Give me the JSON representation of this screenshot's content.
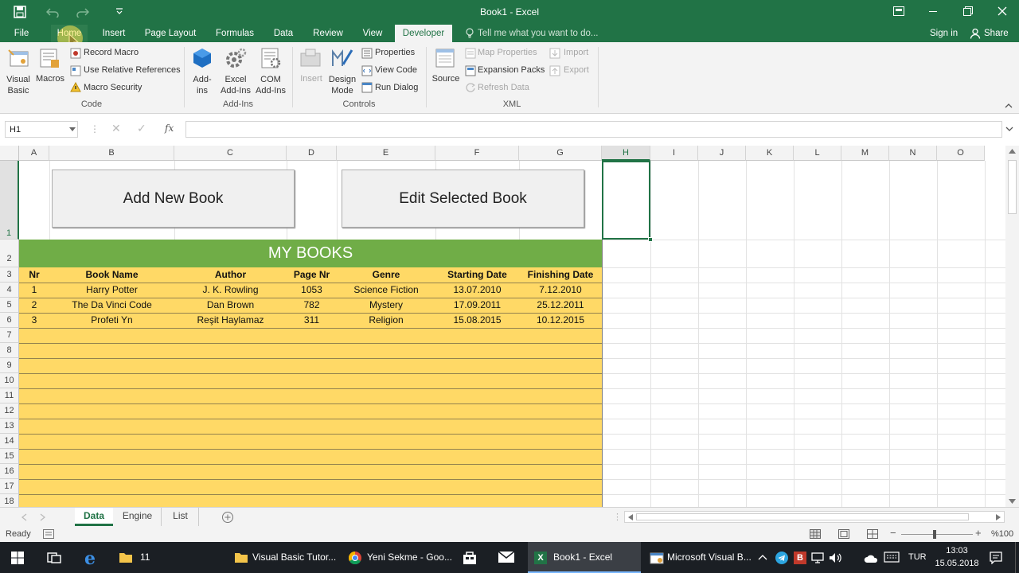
{
  "window": {
    "title": "Book1 - Excel"
  },
  "tabs": [
    "File",
    "Home",
    "Insert",
    "Page Layout",
    "Formulas",
    "Data",
    "Review",
    "View",
    "Developer"
  ],
  "tell_me": "Tell me what you want to do...",
  "sign_in": "Sign in",
  "share": "Share",
  "ribbon": {
    "code": {
      "visual_basic_1": "Visual",
      "visual_basic_2": "Basic",
      "macros": "Macros",
      "record_macro": "Record Macro",
      "relative_refs": "Use Relative References",
      "macro_security": "Macro Security",
      "label": "Code"
    },
    "addins": {
      "addins_1": "Add-",
      "addins_2": "ins",
      "excel_1": "Excel",
      "excel_2": "Add-Ins",
      "com_1": "COM",
      "com_2": "Add-Ins",
      "label": "Add-Ins"
    },
    "controls": {
      "insert": "Insert",
      "design_1": "Design",
      "design_2": "Mode",
      "properties": "Properties",
      "view_code": "View Code",
      "run_dialog": "Run Dialog",
      "label": "Controls"
    },
    "xml": {
      "source": "Source",
      "map_properties": "Map Properties",
      "expansion_packs": "Expansion Packs",
      "refresh_data": "Refresh Data",
      "import": "Import",
      "export": "Export",
      "label": "XML"
    }
  },
  "name_box": "H1",
  "fx": "fx",
  "columns": [
    "A",
    "B",
    "C",
    "D",
    "E",
    "F",
    "G",
    "H",
    "I",
    "J",
    "K",
    "L",
    "M",
    "N",
    "O"
  ],
  "rows": [
    "1",
    "2",
    "3",
    "4",
    "5",
    "6",
    "7",
    "8",
    "9",
    "10",
    "11",
    "12",
    "13",
    "14",
    "15",
    "16",
    "17",
    "18"
  ],
  "buttons": {
    "add": "Add New Book",
    "edit": "Edit Selected Book"
  },
  "table": {
    "title": "MY BOOKS",
    "headers": [
      "Nr",
      "Book Name",
      "Author",
      "Page Nr",
      "Genre",
      "Starting Date",
      "Finishing Date"
    ],
    "rows": [
      [
        "1",
        "Harry Potter",
        "J. K. Rowling",
        "1053",
        "Science Fiction",
        "13.07.2010",
        "7.12.2010"
      ],
      [
        "2",
        "The Da Vinci Code",
        "Dan Brown",
        "782",
        "Mystery",
        "17.09.2011",
        "25.12.2011"
      ],
      [
        "3",
        "Profeti Yn",
        "Reşit Haylamaz",
        "311",
        "Religion",
        "15.08.2015",
        "10.12.2015"
      ]
    ]
  },
  "sheets": [
    "Data",
    "Engine",
    "List"
  ],
  "status": {
    "ready": "Ready",
    "zoom": "%100"
  },
  "taskbar": {
    "folder_11": "11",
    "vb_tutor": "Visual Basic Tutor...",
    "chrome": "Yeni Sekme - Goo...",
    "excel": "Book1 - Excel",
    "vb_editor": "Microsoft Visual B...",
    "lang": "TUR",
    "time": "13:03",
    "date": "15.05.2018"
  },
  "colors": {
    "excel_green": "#217346",
    "title_green": "#70ad47",
    "table_yellow": "#ffd966"
  }
}
